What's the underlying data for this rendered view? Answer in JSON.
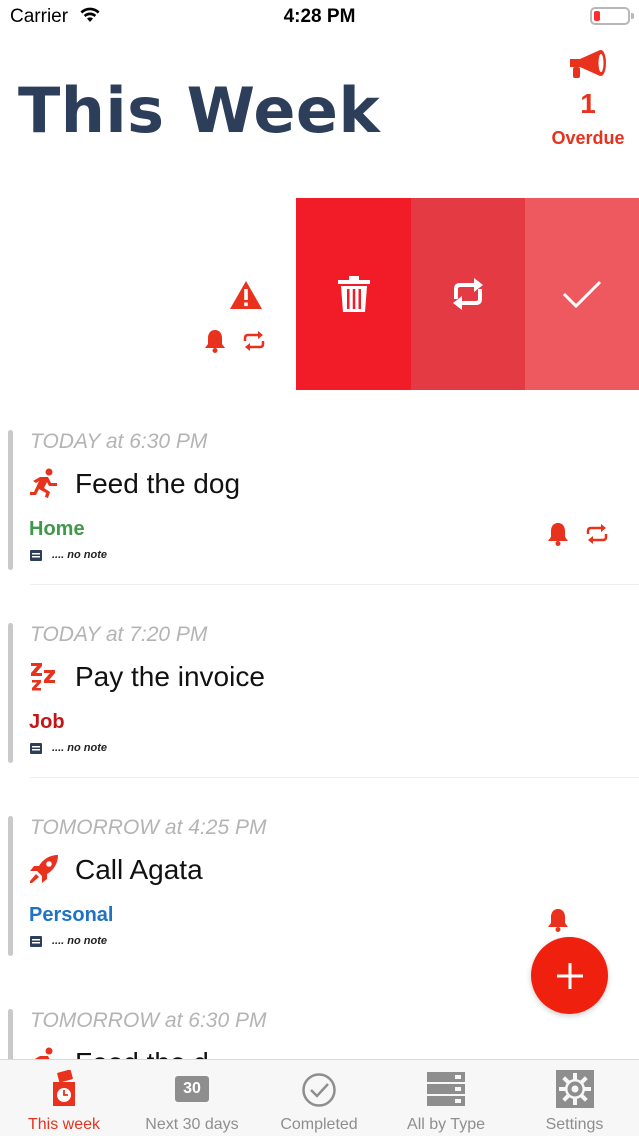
{
  "status_bar": {
    "carrier": "Carrier",
    "time": "4:28 PM"
  },
  "header": {
    "title": "This Week"
  },
  "overdue": {
    "count": "1",
    "label": "Overdue",
    "icon": "megaphone-icon"
  },
  "swipe_actions": [
    {
      "name": "delete",
      "icon": "trash-icon"
    },
    {
      "name": "repeat",
      "icon": "repeat-icon"
    },
    {
      "name": "done",
      "icon": "checkmark-icon"
    }
  ],
  "tasks": [
    {
      "date": "TODAY at 6:30 PM",
      "title": "Feed the dog",
      "category": "Home",
      "category_color": "#3e9a49",
      "note": ".... no note",
      "icon": "running-icon",
      "bell": true,
      "repeat": true
    },
    {
      "date": "TODAY at 7:20 PM",
      "title": "Pay the invoice",
      "category": "Job",
      "category_color": "#c81414",
      "note": ".... no note",
      "icon": "sleep-icon",
      "bell": false,
      "repeat": false
    },
    {
      "date": "TOMORROW at 4:25 PM",
      "title": "Call Agata",
      "category": "Personal",
      "category_color": "#1f72c6",
      "note": ".... no note",
      "icon": "rocket-icon",
      "bell": true,
      "repeat": false
    },
    {
      "date": "TOMORROW at 6:30 PM",
      "title": "Feed the d",
      "category": "",
      "note": "",
      "icon": "running-icon"
    }
  ],
  "tabs": [
    {
      "label": "This week",
      "icon": "this-week-icon",
      "active": true
    },
    {
      "label": "Next 30 days",
      "icon": "calendar-30-icon",
      "cal_number": "30",
      "active": false
    },
    {
      "label": "Completed",
      "icon": "check-circle-icon",
      "active": false
    },
    {
      "label": "All by Type",
      "icon": "stack-icon",
      "active": false
    },
    {
      "label": "Settings",
      "icon": "gear-icon",
      "active": false
    }
  ],
  "colors": {
    "accent": "#e8321e",
    "title": "#2c3e5a",
    "delete": "#f21c28",
    "repeat": "#e43a44",
    "done": "#ee5960"
  }
}
